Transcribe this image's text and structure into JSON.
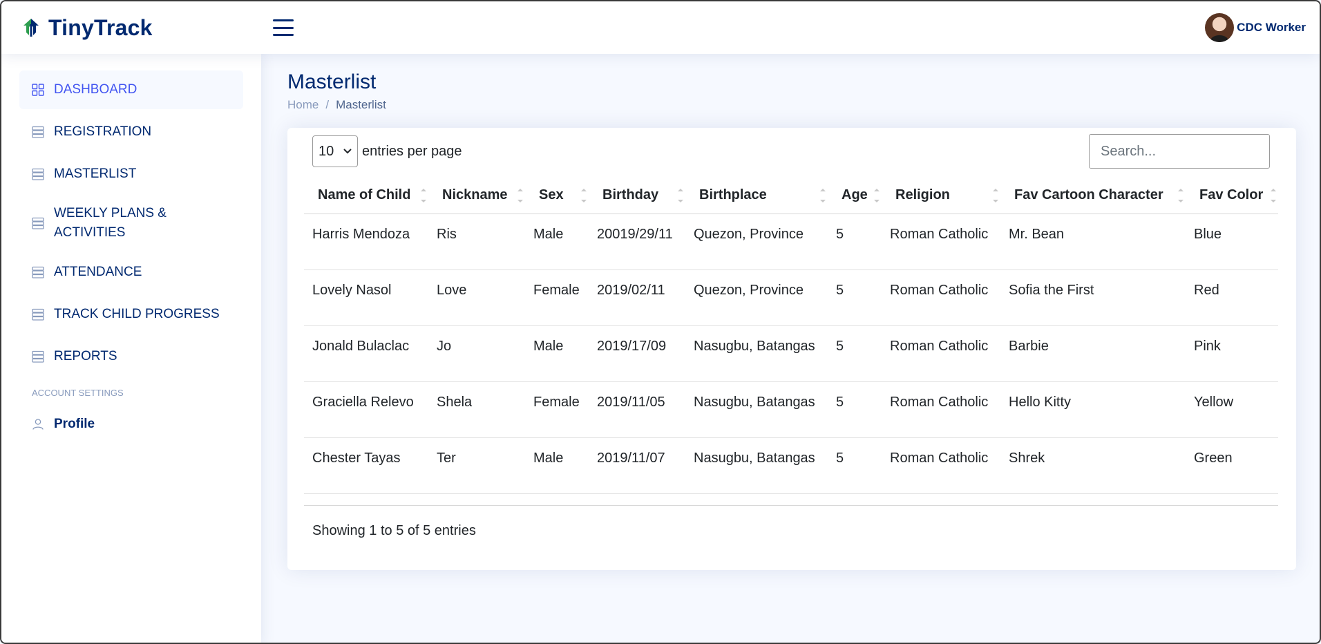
{
  "app": {
    "name": "TinyTrack"
  },
  "header": {
    "user_name": "CDC Worker"
  },
  "sidebar": {
    "items": [
      {
        "label": "DASHBOARD",
        "active": true
      },
      {
        "label": "REGISTRATION"
      },
      {
        "label": "MASTERLIST"
      },
      {
        "label": "WEEKLY PLANS & ACTIVITIES"
      },
      {
        "label": "ATTENDANCE"
      },
      {
        "label": "TRACK CHILD PROGRESS"
      },
      {
        "label": "REPORTS"
      }
    ],
    "section_heading": "ACCOUNT SETTINGS",
    "profile_label": "Profile"
  },
  "page": {
    "title": "Masterlist",
    "breadcrumb": {
      "home": "Home",
      "separator": "/",
      "current": "Masterlist"
    }
  },
  "table_controls": {
    "per_page_value": "10",
    "per_page_label": "entries per page",
    "search_placeholder": "Search..."
  },
  "table": {
    "columns": [
      "Name of Child",
      "Nickname",
      "Sex",
      "Birthday",
      "Birthplace",
      "Age",
      "Religion",
      "Fav Cartoon Character",
      "Fav Color"
    ],
    "rows": [
      [
        "Harris Mendoza",
        "Ris",
        "Male",
        "20019/29/11",
        "Quezon, Province",
        "5",
        "Roman Catholic",
        "Mr. Bean",
        "Blue"
      ],
      [
        "Lovely Nasol",
        "Love",
        "Female",
        "2019/02/11",
        "Quezon, Province",
        "5",
        "Roman Catholic",
        "Sofia the First",
        "Red"
      ],
      [
        "Jonald Bulaclac",
        "Jo",
        "Male",
        "2019/17/09",
        "Nasugbu, Batangas",
        "5",
        "Roman Catholic",
        "Barbie",
        "Pink"
      ],
      [
        "Graciella Relevo",
        "Shela",
        "Female",
        "2019/11/05",
        "Nasugbu, Batangas",
        "5",
        "Roman Catholic",
        "Hello Kitty",
        "Yellow"
      ],
      [
        "Chester Tayas",
        "Ter",
        "Male",
        "2019/11/07",
        "Nasugbu, Batangas",
        "5",
        "Roman Catholic",
        "Shrek",
        "Green"
      ]
    ],
    "info": "Showing 1 to 5 of 5 entries"
  },
  "colors": {
    "brand": "#012970",
    "accent": "#4154f1",
    "logo_green": "#2e9e4f",
    "background": "#f6f9ff"
  },
  "icons": {
    "logo": "tinytrack-logo-icon",
    "menu": "hamburger-menu-icon",
    "dashboard": "grid-icon",
    "nav": "stacked-list-icon",
    "profile": "person-icon",
    "sort": "sort-arrows-icon"
  }
}
